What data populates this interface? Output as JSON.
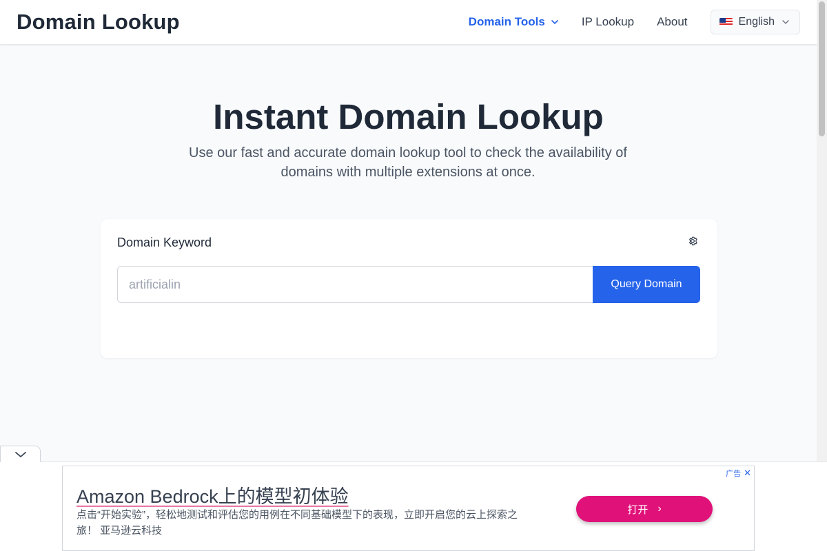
{
  "header": {
    "brand": "Domain Lookup",
    "nav": {
      "domain_tools": "Domain Tools",
      "ip_lookup": "IP Lookup",
      "about": "About"
    },
    "language": "English"
  },
  "hero": {
    "title": "Instant Domain Lookup",
    "subtitle": "Use our fast and accurate domain lookup tool to check the availability of domains with multiple extensions at once."
  },
  "search": {
    "label": "Domain Keyword",
    "placeholder": "artificialin",
    "value": "",
    "button": "Query Domain"
  },
  "ad": {
    "badge": "广告",
    "title": "Amazon Bedrock上的模型初体验",
    "description": "点击“开始实验”，轻松地测试和评估您的用例在不同基础模型下的表现，立即开启您的云上探索之旅！ 亚马逊云科技",
    "open_label": "打开"
  },
  "colors": {
    "accent": "#2563eb",
    "ad_button": "#e0127a",
    "background": "#f8fafc"
  }
}
